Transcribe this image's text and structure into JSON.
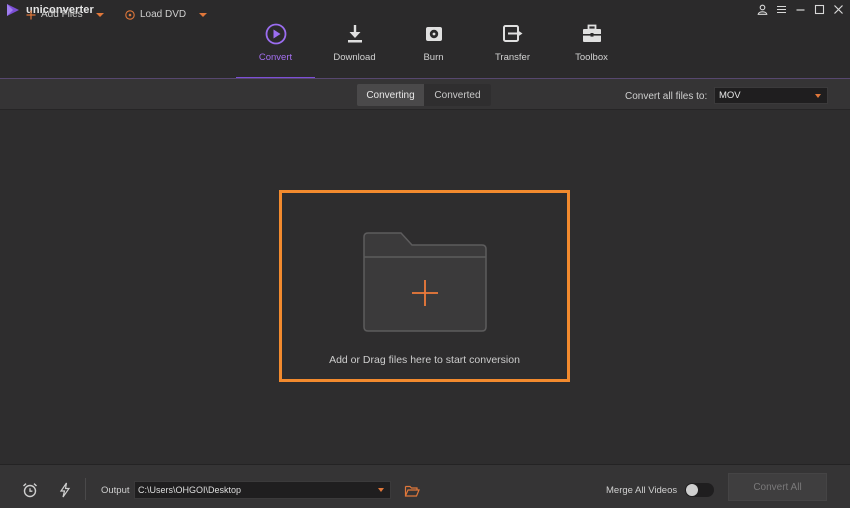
{
  "app": {
    "title": "uniconverter"
  },
  "colors": {
    "accent_purple": "#7c4fd6",
    "accent_orange": "#f28a2e",
    "background": "#2e2d2e"
  },
  "nav": {
    "tabs": [
      {
        "label": "Convert",
        "icon": "convert-icon",
        "active": true
      },
      {
        "label": "Download",
        "icon": "download-icon",
        "active": false
      },
      {
        "label": "Burn",
        "icon": "burn-icon",
        "active": false
      },
      {
        "label": "Transfer",
        "icon": "transfer-icon",
        "active": false
      },
      {
        "label": "Toolbox",
        "icon": "toolbox-icon",
        "active": false
      }
    ]
  },
  "toolbar": {
    "add_files": "Add Files",
    "load_dvd": "Load DVD",
    "segments": [
      {
        "label": "Converting",
        "active": true
      },
      {
        "label": "Converted",
        "active": false
      }
    ],
    "convert_all_label": "Convert all files to:",
    "format_value": "MOV"
  },
  "dropzone": {
    "text": "Add or Drag files here to start conversion"
  },
  "bottom": {
    "output_label": "Output",
    "output_path": "C:\\Users\\OHGOI\\Desktop",
    "merge_label": "Merge All Videos",
    "merge_enabled": false,
    "convert_all_button": "Convert All"
  }
}
